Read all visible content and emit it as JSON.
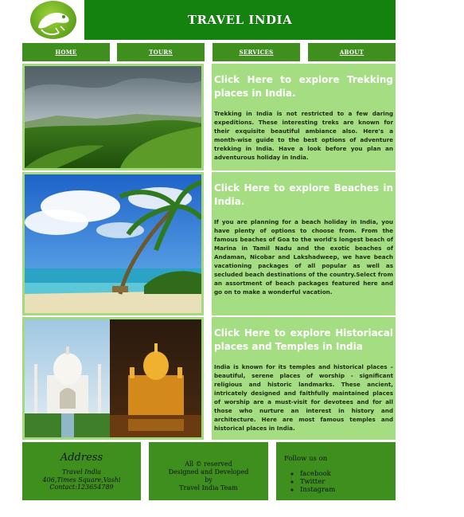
{
  "header": {
    "title": "TRAVEL INDIA",
    "logo_icon": "chameleon-logo-icon",
    "color": "#13820f"
  },
  "nav": {
    "items": [
      {
        "label": "HOME"
      },
      {
        "label": "TOURS"
      },
      {
        "label": "SERVICES"
      },
      {
        "label": "ABOUT"
      }
    ]
  },
  "sections": [
    {
      "image": "mountain-landscape-image",
      "link": "Click Here to explore Trekking places in India.",
      "description": "Trekking in India is not restricted to a few daring expeditions. These interesting treks are known for their exquisite beautiful ambiance also. Here's a month-wise guide to the best options of adventure trekking in India. Have a look before you plan an adventurous holiday in India."
    },
    {
      "image": "beach-palm-image",
      "link": "Click Here to explore Beaches in India.",
      "description": "If you are planning for a beach holiday in India, you have plenty of options to choose from. From the famous beaches of Goa to the world's longest beach of Marina in Tamil Nadu and the exotic beaches of Andaman, Nicobar and Lakshadweep, we have beach vacationing packages of all popular as well as secluded beach destinations of the country.Select from an assortment of beach packages featured here and go on to make a wonderful vacation."
    },
    {
      "image": "taj-mahal-golden-temple-image",
      "link": "Click Here to explore Historiacal places and Temples in India",
      "description": "India is known for its temples and historical places – beautiful, serene places of worship - significant religious and historic landmarks. These ancient, intricately designed and faithfully maintained places of worship are a must-visit for devotees and for all those who nurture an interest in history and architecture. Here are most famous temples and historical places in India."
    }
  ],
  "footer": {
    "address": {
      "title": "Address",
      "lines": [
        "Travel India",
        "406,Times Square,Vashi",
        "Contact:123654789"
      ]
    },
    "center_lines": [
      "All © reserved",
      "Designed and Developed",
      "by",
      "Travel India Team"
    ],
    "follow": {
      "title": "Follow us on",
      "links": [
        "facebook",
        "Twitter",
        "Instagram"
      ]
    }
  }
}
